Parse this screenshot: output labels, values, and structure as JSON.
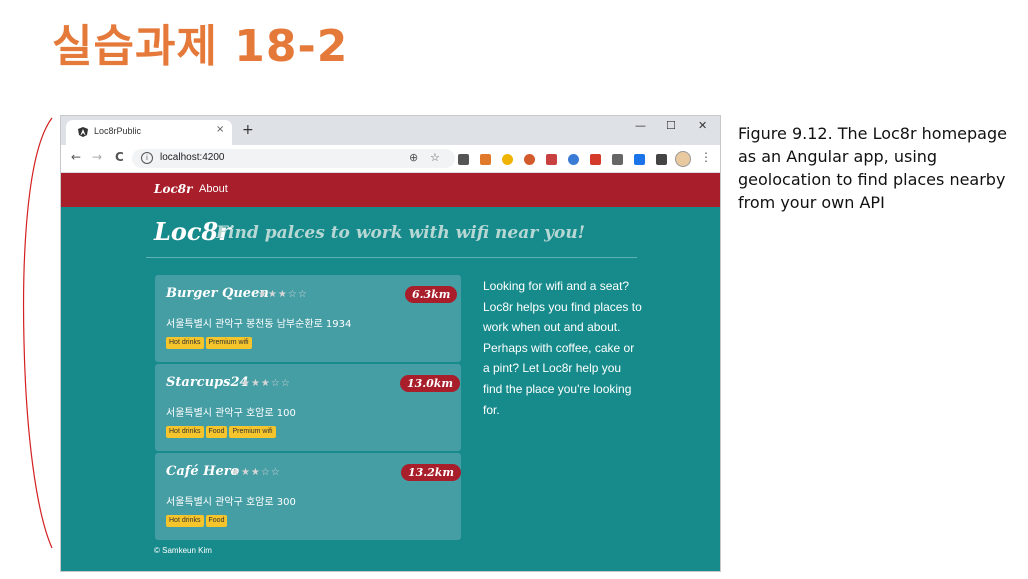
{
  "slide": {
    "title": "실습과제 18-2",
    "caption": "Figure 9.12. The Loc8r homepage as an Angular app, using geolocation to find places nearby from your own API"
  },
  "browser": {
    "tab_title": "Loc8rPublic",
    "tab_close": "×",
    "new_tab": "+",
    "minimize": "—",
    "maximize": "☐",
    "close": "✕",
    "back": "←",
    "forward": "→",
    "reload": "C",
    "url": "localhost:4200",
    "location_icon": "⊕",
    "bookmark_icon": "☆",
    "menu_icon": "⋮"
  },
  "app": {
    "brand": "Loc8r",
    "nav_about": "About",
    "banner_logo": "Loc8r",
    "banner_tagline": "Find palces to work with wifi near you!",
    "locations": [
      {
        "name": "Burger Queen",
        "rating": 3,
        "distance": "6.3km",
        "address": "서울특별시 관악구 봉천동 남부순환로 1934",
        "facilities": [
          "Hot drinks",
          "Premium wifi"
        ]
      },
      {
        "name": "Starcups24",
        "rating": 3,
        "distance": "13.0km",
        "address": "서울특별시 관악구 호암로 100",
        "facilities": [
          "Hot drinks",
          "Food",
          "Premium wifi"
        ]
      },
      {
        "name": "Café Hero",
        "rating": 3,
        "distance": "13.2km",
        "address": "서울특별시 관악구 호암로 300",
        "facilities": [
          "Hot drinks",
          "Food"
        ]
      }
    ],
    "sidebar": "Looking for wifi and a seat? Loc8r helps you find places to work when out and about. Perhaps with coffee, cake or a pint? Let Loc8r help you find the place you're looking for.",
    "footer": "© Samkeun Kim"
  },
  "colors": {
    "title_orange": "#E5793A",
    "navbar_red": "#a81e2a",
    "page_teal": "#178b8b",
    "card_teal": "#469ea5",
    "tag_yellow": "#f5c52b"
  }
}
